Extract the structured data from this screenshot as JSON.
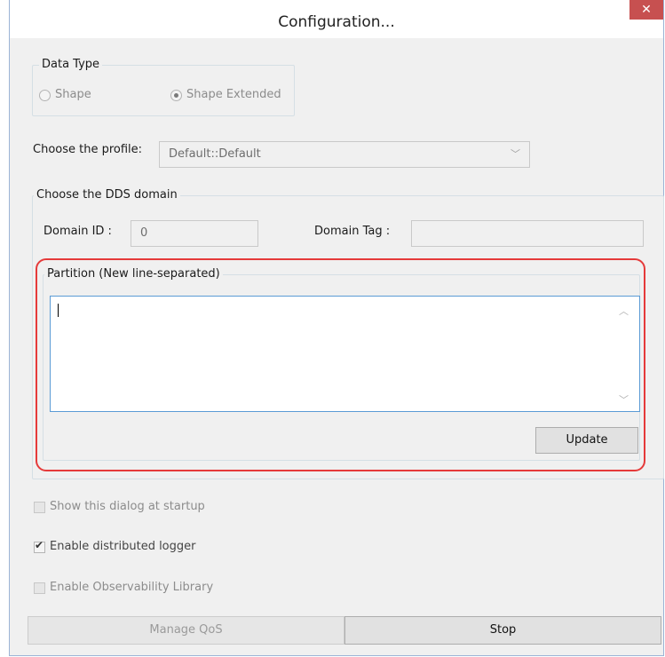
{
  "window": {
    "title": "Configuration...",
    "close_glyph": "✕"
  },
  "data_type": {
    "legend": "Data Type",
    "options": [
      {
        "label": "Shape",
        "selected": false
      },
      {
        "label": "Shape Extended",
        "selected": true
      }
    ]
  },
  "profile": {
    "label": "Choose the profile:",
    "value": "Default::Default",
    "arrow_glyph": "﹀"
  },
  "domain": {
    "legend": "Choose the DDS domain",
    "id_label": "Domain ID :",
    "id_value": "0",
    "tag_label": "Domain Tag :",
    "tag_value": ""
  },
  "partition": {
    "legend": "Partition (New line-separated)",
    "value": "",
    "update_label": "Update",
    "highlight_color": "#e53a3a"
  },
  "options": {
    "show_dialog_label": "Show this dialog at startup",
    "show_dialog_checked": false,
    "distributed_logger_label": "Enable distributed logger",
    "distributed_logger_checked": true,
    "observability_label": "Enable Observability Library",
    "observability_checked": false
  },
  "footer": {
    "manage_qos_label": "Manage QoS",
    "stop_label": "Stop"
  }
}
